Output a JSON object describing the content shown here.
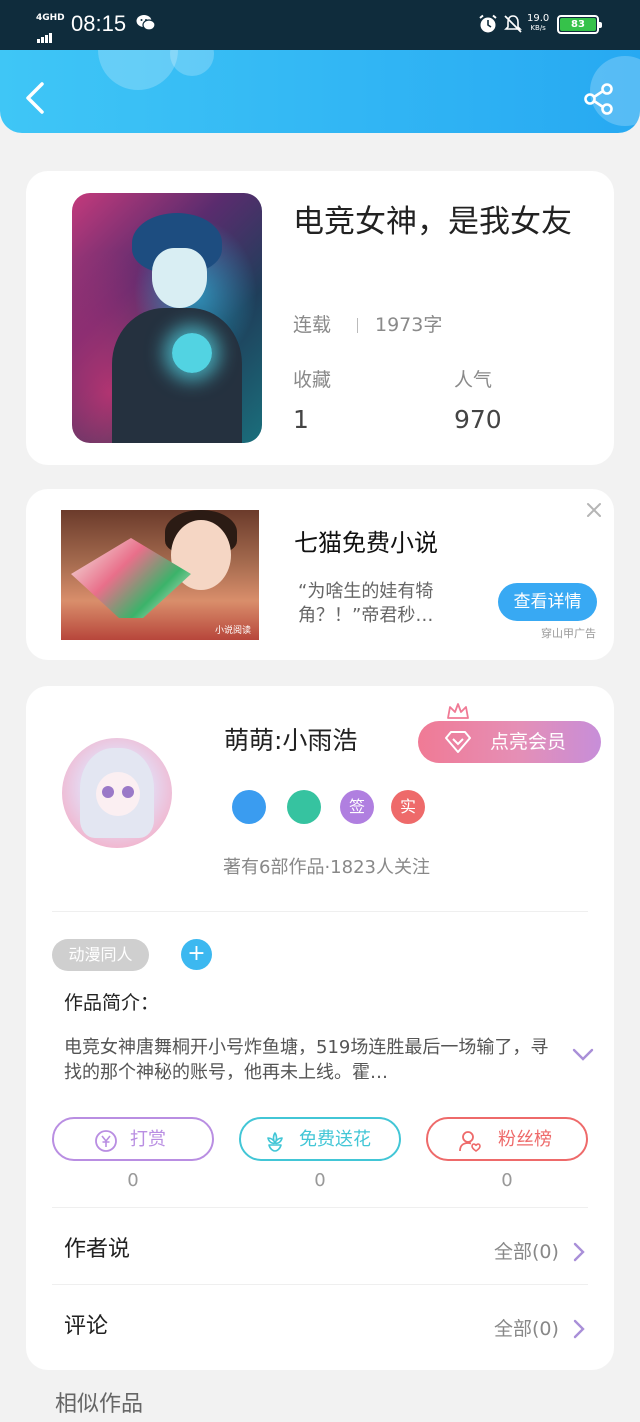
{
  "status_bar": {
    "network": "4GHD",
    "time": "08:15",
    "speed_value": "19.0",
    "speed_unit": "KB/s",
    "battery": "83"
  },
  "header": {
    "back_icon": "chevron-left-icon",
    "share_icon": "share-icon",
    "colors": {
      "start": "#3fc6f6",
      "end": "#27a9f2"
    }
  },
  "book": {
    "title": "电竞女神，是我女友",
    "status": "连载",
    "word_count": "1973字",
    "favorites_label": "收藏",
    "favorites_value": "1",
    "popularity_label": "人气",
    "popularity_value": "970"
  },
  "ad": {
    "title": "七猫免费小说",
    "description": "“为啥生的娃有犄角？！”帝君秒…",
    "button": "查看详情",
    "source": "穿山甲广告",
    "image_watermark": "小说阅读"
  },
  "author": {
    "name": "萌萌:小雨浩",
    "vip_button": "点亮会员",
    "badges": [
      {
        "icon": "music-badge-icon",
        "text": "",
        "color": "#3a9cf0"
      },
      {
        "icon": "handshake-badge-icon",
        "text": "",
        "color": "#36c3a0"
      },
      {
        "icon": "sign-badge-icon",
        "text": "签",
        "color": "#b07fe0"
      },
      {
        "icon": "verified-badge-icon",
        "text": "实",
        "color": "#ee6a6a"
      }
    ],
    "stats": "著有6部作品·1823人关注"
  },
  "tags": {
    "items": [
      "动漫同人"
    ],
    "add_label": "+"
  },
  "intro": {
    "label": "作品简介：",
    "text": "电竞女神唐舞桐开小号炸鱼塘，519场连胜最后一场输了，寻找的那个神秘的账号，他再未上线。霍…"
  },
  "actions": [
    {
      "label": "打赏",
      "count": "0",
      "color": "#b98ee2",
      "icon": "coin-icon"
    },
    {
      "label": "免费送花",
      "count": "0",
      "color": "#42c6d6",
      "icon": "flower-icon"
    },
    {
      "label": "粉丝榜",
      "count": "0",
      "color": "#ee6a6a",
      "icon": "fan-icon"
    }
  ],
  "author_says": {
    "label": "作者说",
    "more": "全部(0)"
  },
  "comments": {
    "label": "评论",
    "more": "全部(0)"
  },
  "similar": {
    "label": "相似作品"
  }
}
